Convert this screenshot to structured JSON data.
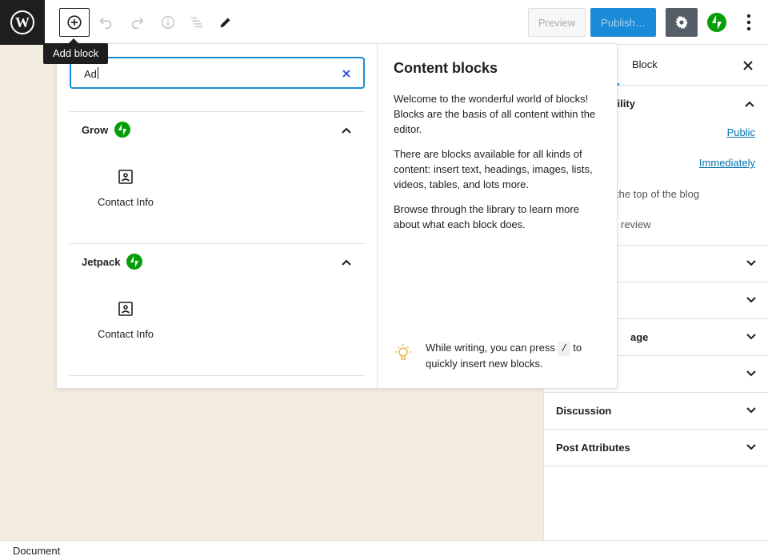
{
  "toolbar": {
    "add_block_tooltip": "Add block",
    "preview_label": "Preview",
    "publish_label": "Publish…",
    "icons": {
      "wordpress": "wordpress-logo-icon",
      "add": "plus-circle-icon",
      "undo": "undo-icon",
      "redo": "redo-icon",
      "info": "info-icon",
      "outline": "list-view-icon",
      "edit": "pencil-icon",
      "settings": "gear-icon",
      "jetpack": "jetpack-icon",
      "more": "more-vertical-icon"
    }
  },
  "inserter": {
    "search_value": "Ad",
    "categories": [
      {
        "title": "Grow",
        "blocks": [
          {
            "label": "Contact Info"
          }
        ]
      },
      {
        "title": "Jetpack",
        "blocks": [
          {
            "label": "Contact Info"
          }
        ]
      }
    ],
    "info": {
      "heading": "Content blocks",
      "paragraphs": [
        "Welcome to the wonderful world of blocks! Blocks are the basis of all content within the editor.",
        "There are blocks available for all kinds of content: insert text, headings, images, lists, videos, tables, and lots more.",
        "Browse through the library to learn more about what each block does."
      ],
      "tip_before": "While writing, you can press",
      "tip_key": "/",
      "tip_after": "to quickly insert new blocks."
    }
  },
  "sidebar": {
    "tab_block": "Block",
    "status_title": "ibility",
    "visibility_value": "Public",
    "publish_value": "Immediately",
    "sticky_text": "the top of the blog",
    "review_text": "review",
    "panels": [
      {
        "title": ""
      },
      {
        "title": ""
      },
      {
        "title": "age"
      },
      {
        "title": ""
      },
      {
        "title": "Discussion"
      },
      {
        "title": "Post Attributes"
      }
    ]
  },
  "footer": {
    "breadcrumb": "Document"
  },
  "colors": {
    "accent": "#1a8bd6",
    "jetpack": "#069e08",
    "tip": "#f0b849",
    "canvas": "#f3ede0"
  }
}
